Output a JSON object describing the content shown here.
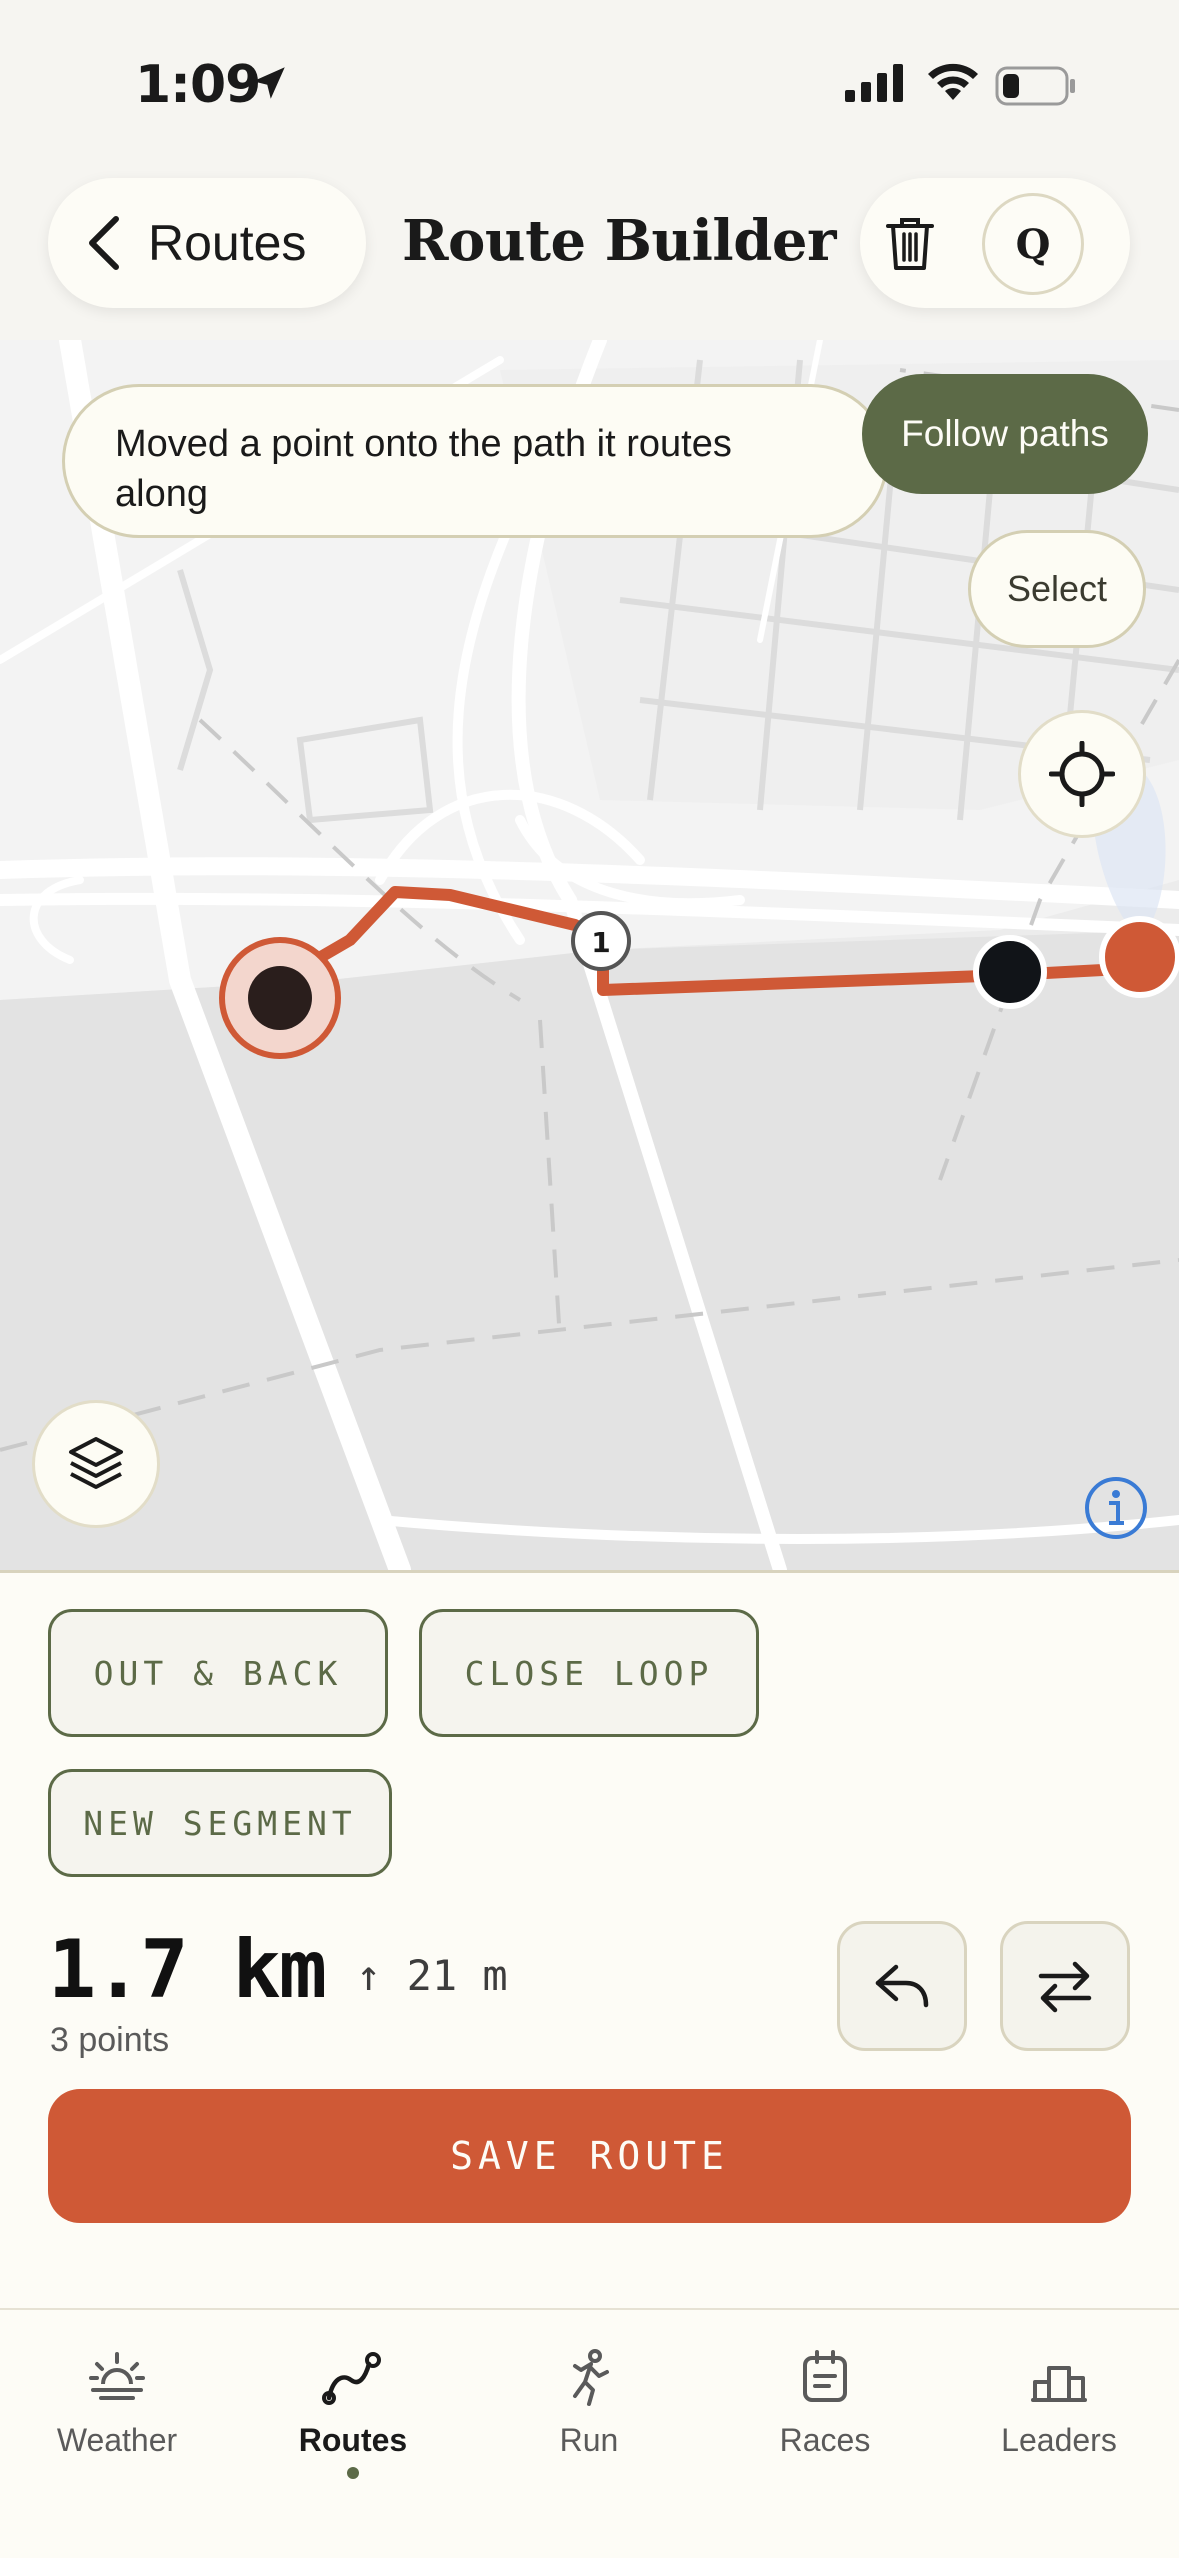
{
  "status_bar": {
    "time": "1:09"
  },
  "header": {
    "back_label": "Routes",
    "title": "Route Builder",
    "avatar_initial": "Q"
  },
  "map": {
    "toast": "Moved a point onto the path it routes along",
    "follow_paths_label": "Follow paths",
    "select_label": "Select",
    "waypoint_badge": "1"
  },
  "actions": {
    "out_back": "OUT & BACK",
    "close_loop": "CLOSE LOOP",
    "new_segment": "NEW SEGMENT"
  },
  "stats": {
    "distance": "1.7 km",
    "elevation": "↑ 21 m",
    "points": "3 points"
  },
  "save_label": "SAVE ROUTE",
  "tabs": [
    {
      "label": "Weather",
      "icon": "sunrise-icon"
    },
    {
      "label": "Routes",
      "icon": "route-icon",
      "active": true
    },
    {
      "label": "Run",
      "icon": "runner-icon"
    },
    {
      "label": "Races",
      "icon": "calendar-icon"
    },
    {
      "label": "Leaders",
      "icon": "podium-icon"
    }
  ],
  "colors": {
    "accent": "#cf5936",
    "olive": "#5c6a47",
    "background": "#fdfcf6"
  }
}
